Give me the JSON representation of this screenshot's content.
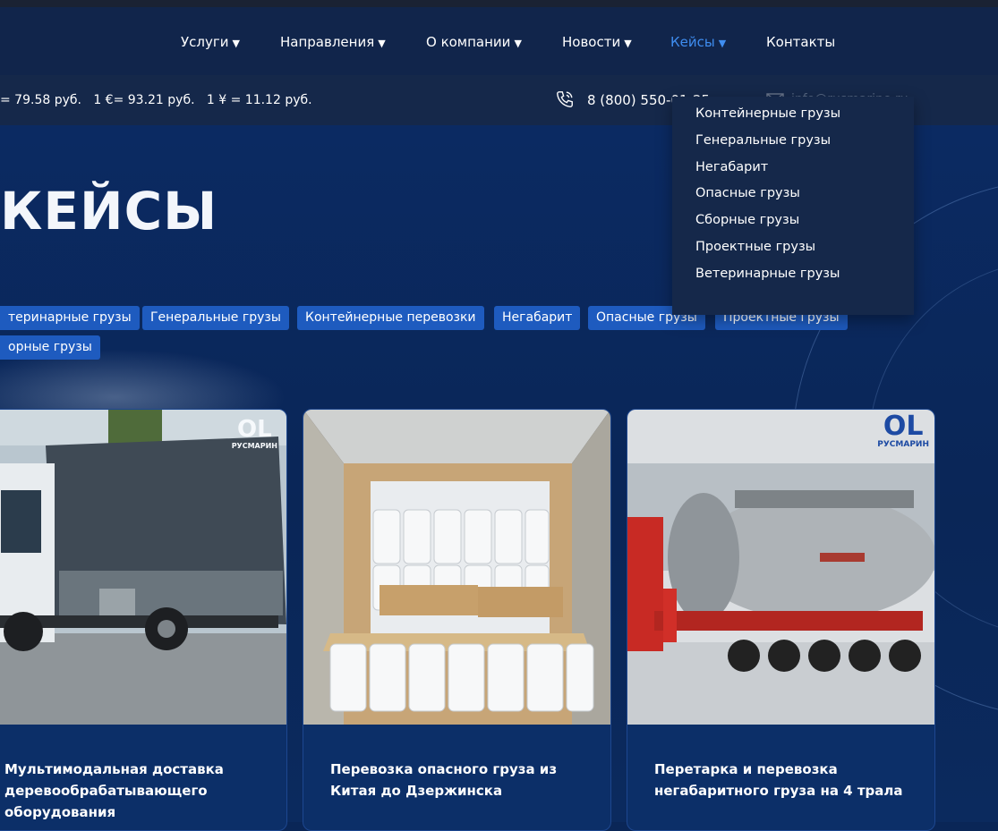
{
  "nav": {
    "items": [
      {
        "label": "Услуги",
        "arrow": "▼"
      },
      {
        "label": "Направления",
        "arrow": "▼"
      },
      {
        "label": "О компании",
        "arrow": "▼"
      },
      {
        "label": "Новости",
        "arrow": "▼"
      },
      {
        "label": "Кейсы",
        "arrow": "▼"
      },
      {
        "label": "Контакты"
      }
    ],
    "active_color": "#3f8df0"
  },
  "infobar": {
    "rates": "= 79.58 руб.   1 €= 93.21 руб.   1 ¥ = 11.12 руб.",
    "phone": "8 (800) 550-01-25",
    "email": "info@rusmarine.ru"
  },
  "page": {
    "title": "КЕЙСЫ"
  },
  "tags": [
    "теринарные грузы",
    "Генеральные грузы",
    "Контейнерные перевозки",
    "Негабарит",
    "Опасные грузы",
    "Проектные грузы",
    "орные грузы"
  ],
  "cards": [
    {
      "title": "Мультимодальная доставка деревообрабатывающего оборудования",
      "logo": "РУСМАРИН",
      "logo_mark": "OL"
    },
    {
      "title": "Перевозка опасного груза из Китая до Дзержинска"
    },
    {
      "title": "Перетарка и перевозка негабаритного груза на 4 трала",
      "logo": "РУСМАРИН",
      "logo_mark": "OL"
    }
  ],
  "dropdown": {
    "items": [
      "Контейнерные грузы",
      "Генеральные грузы",
      "Негабарит",
      "Опасные грузы",
      "Сборные грузы",
      "Проектные грузы",
      "Ветеринарные грузы"
    ]
  },
  "colors": {
    "background": "#0a2657",
    "nav_background": "#11254b",
    "tag_background": "#1e5bbf",
    "accent": "#3f8df0"
  }
}
